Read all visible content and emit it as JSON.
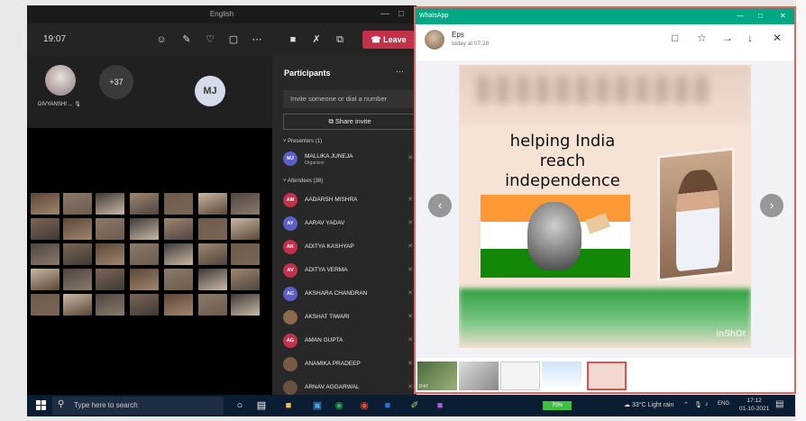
{
  "teams": {
    "window_title": "English",
    "time": "19:07",
    "leave_label": "Leave",
    "participant_name": "DIVYANSHI ...",
    "more_count": "+37",
    "mj_initials": "MJ",
    "panel": {
      "title": "Participants",
      "invite_placeholder": "Invite someone or dial a number",
      "share_label": "Share invite",
      "presenters_label": "Presenters (1)",
      "attendees_label": "Attendees (38)",
      "presenter": {
        "initials": "MJ",
        "name": "MALLIKA JUNEJA",
        "role": "Organizer",
        "color": "#5b5fc7"
      },
      "attendees": [
        {
          "initials": "AM",
          "name": "AADARSH MISHRA",
          "color": "#c4314b"
        },
        {
          "initials": "AY",
          "name": "AARAV YADAV",
          "color": "#5b5fc7"
        },
        {
          "initials": "AK",
          "name": "ADITYA KASHYAP",
          "color": "#c4314b"
        },
        {
          "initials": "AV",
          "name": "ADITYA VERMA",
          "color": "#c4314b"
        },
        {
          "initials": "AC",
          "name": "AKSHARA CHANDRAN",
          "color": "#5b5fc7"
        },
        {
          "initials": "",
          "name": "AKSHAT TIWARI",
          "color": "#8a6a4a"
        },
        {
          "initials": "AG",
          "name": "AMAN GUPTA",
          "color": "#c4314b"
        },
        {
          "initials": "",
          "name": "ANAMIKA PRADEEP",
          "color": "#7a5a44"
        },
        {
          "initials": "",
          "name": "ARNAV AGGARWAL",
          "color": "#6a5040"
        }
      ]
    }
  },
  "whatsapp": {
    "window_title": "WhatsApp",
    "sender": "Eps",
    "timestamp": "today at 07:28",
    "poster_caption_line1": "helping India",
    "poster_caption_line2": "reach",
    "poster_caption_line3": "independence",
    "watermark": "inShOt",
    "thumb_video_label": "0:47"
  },
  "taskbar": {
    "search_placeholder": "Type here to search",
    "battery_label": "70%",
    "weather": "33°C  Light rain",
    "language": "ENG",
    "time": "17:12",
    "date": "01-10-2021"
  },
  "colors": {
    "teams_bg": "#1f1f1f",
    "leave": "#c4314b",
    "whatsapp_green": "#00a884",
    "taskbar": "#0b1d33"
  }
}
